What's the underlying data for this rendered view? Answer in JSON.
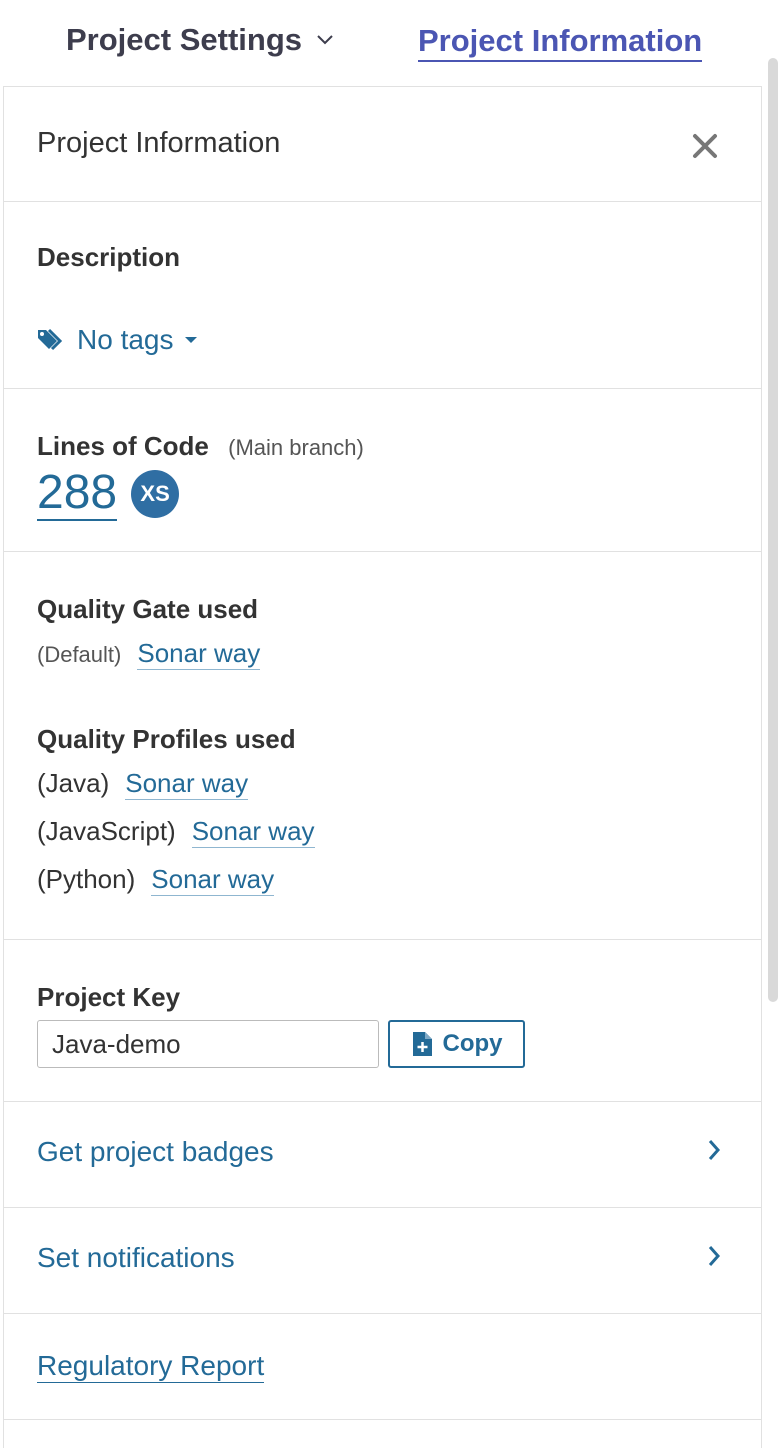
{
  "topbar": {
    "settings_label": "Project Settings",
    "info_label": "Project Information"
  },
  "panel": {
    "title": "Project Information",
    "description_heading": "Description",
    "tags_label": "No tags",
    "loc": {
      "heading": "Lines of Code",
      "branch": "(Main branch)",
      "value": "288",
      "size": "XS"
    },
    "quality_gate": {
      "heading": "Quality Gate used",
      "prefix": "(Default)",
      "name": "Sonar way"
    },
    "quality_profiles": {
      "heading": "Quality Profiles used",
      "items": [
        {
          "language": "(Java)",
          "name": "Sonar way"
        },
        {
          "language": "(JavaScript)",
          "name": "Sonar way"
        },
        {
          "language": "(Python)",
          "name": "Sonar way"
        }
      ]
    },
    "project_key": {
      "heading": "Project Key",
      "value": "Java-demo",
      "copy_label": "Copy"
    },
    "nav": {
      "badges_label": "Get project badges",
      "notifications_label": "Set notifications",
      "report_label": "Regulatory Report"
    }
  },
  "colors": {
    "link": "#236a97",
    "header_link": "#4b56b3",
    "badge": "#2f6ea3",
    "border": "#e1e1e1"
  }
}
